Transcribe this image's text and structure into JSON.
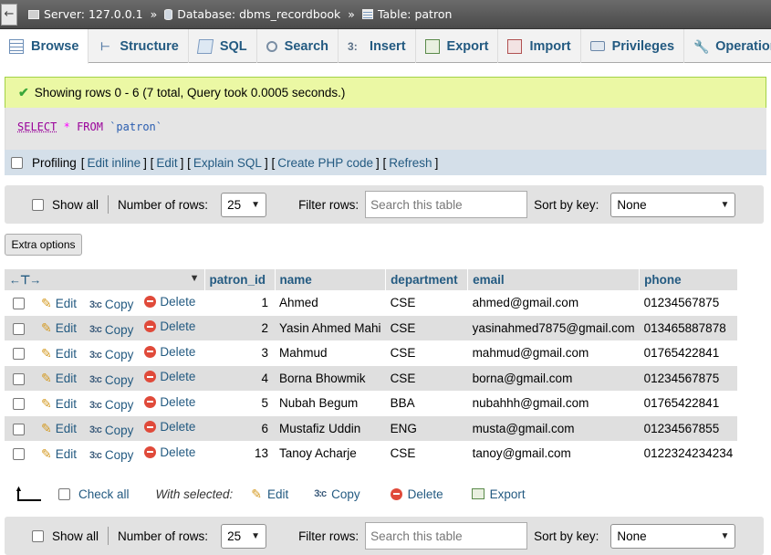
{
  "breadcrumb": {
    "server": "Server: 127.0.0.1",
    "database": "Database: dbms_recordbook",
    "table": "Table: patron",
    "separator": "»"
  },
  "tabs": [
    {
      "label": "Browse",
      "icon": "browse-icon",
      "active": true
    },
    {
      "label": "Structure",
      "icon": "structure-icon"
    },
    {
      "label": "SQL",
      "icon": "sql-icon"
    },
    {
      "label": "Search",
      "icon": "search-icon"
    },
    {
      "label": "Insert",
      "icon": "insert-icon"
    },
    {
      "label": "Export",
      "icon": "export-icon"
    },
    {
      "label": "Import",
      "icon": "import-icon"
    },
    {
      "label": "Privileges",
      "icon": "privileges-icon"
    },
    {
      "label": "Operations",
      "icon": "operations-icon"
    }
  ],
  "message": {
    "text": "Showing rows 0 - 6 (7 total, Query took 0.0005 seconds.)",
    "color": "#ebf8a4"
  },
  "query": {
    "select": "SELECT",
    "star": "*",
    "from": "FROM",
    "table": "`patron`"
  },
  "profiling": {
    "label": "Profiling",
    "links": [
      "Edit inline",
      "Edit",
      "Explain SQL",
      "Create PHP code",
      "Refresh"
    ]
  },
  "navigation": {
    "show_all": "Show all",
    "rows_label": "Number of rows:",
    "rows_value": "25",
    "filter_label": "Filter rows:",
    "filter_placeholder": "Search this table",
    "sort_label": "Sort by key:",
    "sort_value": "None"
  },
  "extra_options": "Extra options",
  "table": {
    "headers": [
      "patron_id",
      "name",
      "department",
      "email",
      "phone"
    ],
    "actions": {
      "edit": "Edit",
      "copy": "Copy",
      "delete": "Delete"
    },
    "rows": [
      {
        "patron_id": "1",
        "name": "Ahmed",
        "department": "CSE",
        "email": "ahmed@gmail.com",
        "phone": "01234567875"
      },
      {
        "patron_id": "2",
        "name": "Yasin Ahmed Mahi",
        "department": "CSE",
        "email": "yasinahmed7875@gmail.com",
        "phone": "013465887878"
      },
      {
        "patron_id": "3",
        "name": "Mahmud",
        "department": "CSE",
        "email": "mahmud@gmail.com",
        "phone": "01765422841"
      },
      {
        "patron_id": "4",
        "name": "Borna Bhowmik",
        "department": "CSE",
        "email": "borna@gmail.com",
        "phone": "01234567875"
      },
      {
        "patron_id": "5",
        "name": "Nubah Begum",
        "department": "BBA",
        "email": "nubahhh@gmail.com",
        "phone": "01765422841"
      },
      {
        "patron_id": "6",
        "name": "Mustafiz Uddin",
        "department": "ENG",
        "email": "musta@gmail.com",
        "phone": "01234567855"
      },
      {
        "patron_id": "13",
        "name": "Tanoy Acharje",
        "department": "CSE",
        "email": "tanoy@gmail.com",
        "phone": "0122324234234"
      }
    ]
  },
  "with_selected": {
    "check_all": "Check all",
    "label": "With selected:",
    "edit": "Edit",
    "copy": "Copy",
    "delete": "Delete",
    "export": "Export"
  },
  "colors": {
    "link": "#235a81",
    "success_bg": "#ebf8a4",
    "row_alt": "#dfdfdf"
  }
}
